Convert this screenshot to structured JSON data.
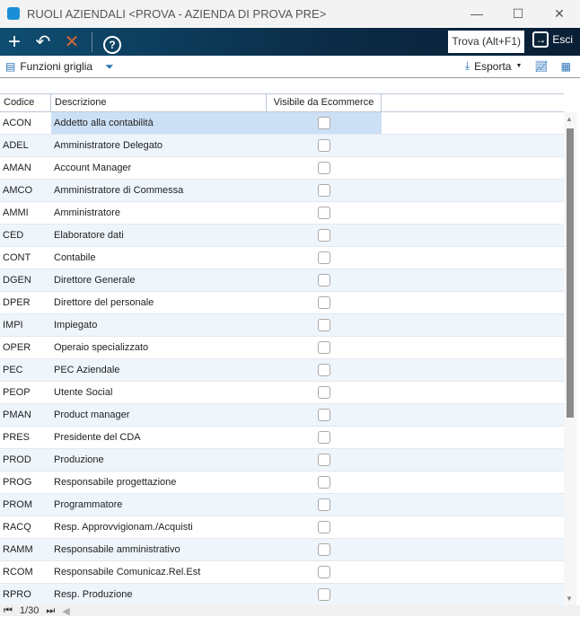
{
  "window": {
    "title": "RUOLI AZIENDALI <PROVA - AZIENDA DI PROVA PRE>",
    "minimize": "—",
    "maximize": "☐",
    "close": "✕"
  },
  "toolbar": {
    "add": "+",
    "undo": "↶",
    "delete": "✕",
    "help": "?",
    "find": "Trova (Alt+F1)",
    "exit": "Esci"
  },
  "funcbar": {
    "grid_functions": "Funzioni griglia",
    "export": "Esporta"
  },
  "grid": {
    "headers": [
      "Codice",
      "Descrizione",
      "Visibile da Ecommerce"
    ],
    "rows": [
      [
        "ACON",
        "Addetto alla contabilità"
      ],
      [
        "ADEL",
        "Amministratore Delegato"
      ],
      [
        "AMAN",
        "Account Manager"
      ],
      [
        "AMCO",
        "Amministratore di Commessa"
      ],
      [
        "AMMI",
        "Amministratore"
      ],
      [
        "CED",
        "Elaboratore dati"
      ],
      [
        "CONT",
        "Contabile"
      ],
      [
        "DGEN",
        "Direttore Generale"
      ],
      [
        "DPER",
        "Direttore del personale"
      ],
      [
        "IMPI",
        "Impiegato"
      ],
      [
        "OPER",
        "Operaio specializzato"
      ],
      [
        "PEC",
        "PEC Aziendale"
      ],
      [
        "PEOP",
        "Utente Social"
      ],
      [
        "PMAN",
        "Product manager"
      ],
      [
        "PRES",
        "Presidente del CDA"
      ],
      [
        "PROD",
        "Produzione"
      ],
      [
        "PROG",
        "Responsabile progettazione"
      ],
      [
        "PROM",
        "Programmatore"
      ],
      [
        "RACQ",
        "Resp. Approvvigionam./Acquisti"
      ],
      [
        "RAMM",
        "Responsabile amministrativo"
      ],
      [
        "RCOM",
        "Responsabile Comunicaz.Rel.Est"
      ],
      [
        "RPRO",
        "Resp. Produzione"
      ]
    ]
  },
  "footer": {
    "page": "1/30"
  }
}
